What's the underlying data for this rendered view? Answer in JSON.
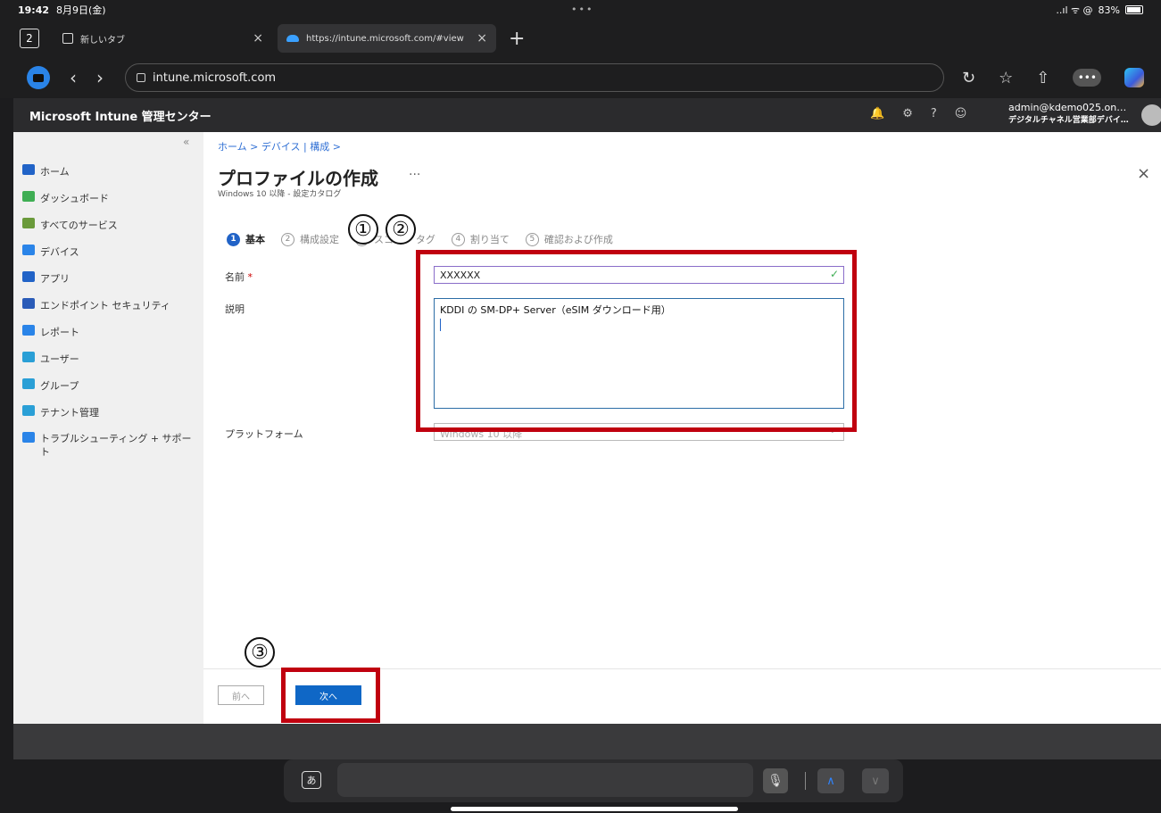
{
  "status": {
    "time": "19:42",
    "date": "8月9日(金)",
    "dots": "•••",
    "signal": "..ıl ᯤ @",
    "battery": "83%"
  },
  "tabs": {
    "count": "2",
    "items": [
      {
        "title": "新しいタブ",
        "close": "×"
      },
      {
        "title": "https://intune.microsoft.com/#view",
        "close": "×"
      }
    ],
    "new": "+"
  },
  "address": {
    "url": "intune.microsoft.com",
    "back": "‹",
    "forward": "›",
    "more": "•••",
    "reload": "↻",
    "favorites": "☆",
    "share": "⇧"
  },
  "header": {
    "title": "Microsoft Intune 管理センター",
    "user": "admin@kdemo025.on…",
    "org": "デジタルチャネル営業部デバイ…",
    "icons": [
      "🔔",
      "⚙",
      "?",
      "☺"
    ]
  },
  "sidebar": {
    "collapse": "«",
    "items": [
      {
        "label": "ホーム",
        "color": "#2163c7"
      },
      {
        "label": "ダッシュボード",
        "color": "#3fae54"
      },
      {
        "label": "すべてのサービス",
        "color": "#6a9a3a"
      },
      {
        "label": "デバイス",
        "color": "#2a84e8"
      },
      {
        "label": "アプリ",
        "color": "#2163c7"
      },
      {
        "label": "エンドポイント セキュリティ",
        "color": "#2a5bb8"
      },
      {
        "label": "レポート",
        "color": "#2a84e8"
      },
      {
        "label": "ユーザー",
        "color": "#2a9fd6"
      },
      {
        "label": "グループ",
        "color": "#2a9fd6"
      },
      {
        "label": "テナント管理",
        "color": "#2a9fd6"
      },
      {
        "label": "トラブルシューティング + サポート",
        "color": "#2a84e8"
      }
    ]
  },
  "main": {
    "breadcrumb": "ホーム > デバイス | 構成 >",
    "title": "プロファイルの作成",
    "title_more": "···",
    "subtitle": "Windows 10 以降 - 設定カタログ",
    "close": "×",
    "steps": [
      {
        "num": "1",
        "label": "基本"
      },
      {
        "num": "2",
        "label": "構成設定"
      },
      {
        "num": "3",
        "label": "スコープ タグ"
      },
      {
        "num": "4",
        "label": "割り当て"
      },
      {
        "num": "5",
        "label": "確認および作成"
      }
    ],
    "form": {
      "name_label": "名前",
      "required": "*",
      "name_value": "XXXXXX",
      "check": "✓",
      "desc_label": "説明",
      "desc_value": "KDDI の SM-DP+ Server（eSIM ダウンロード用）",
      "platform_label": "プラットフォーム",
      "platform_value": "Windows 10 以降",
      "chevron": "⌄"
    },
    "buttons": {
      "prev": "前へ",
      "next": "次へ"
    }
  },
  "annotations": {
    "one": "①",
    "two": "②",
    "three": "③",
    "color": "#c0000f"
  },
  "keyboard": {
    "lang": "あ",
    "mic": "🎙",
    "up": "∧",
    "down": "∨"
  }
}
